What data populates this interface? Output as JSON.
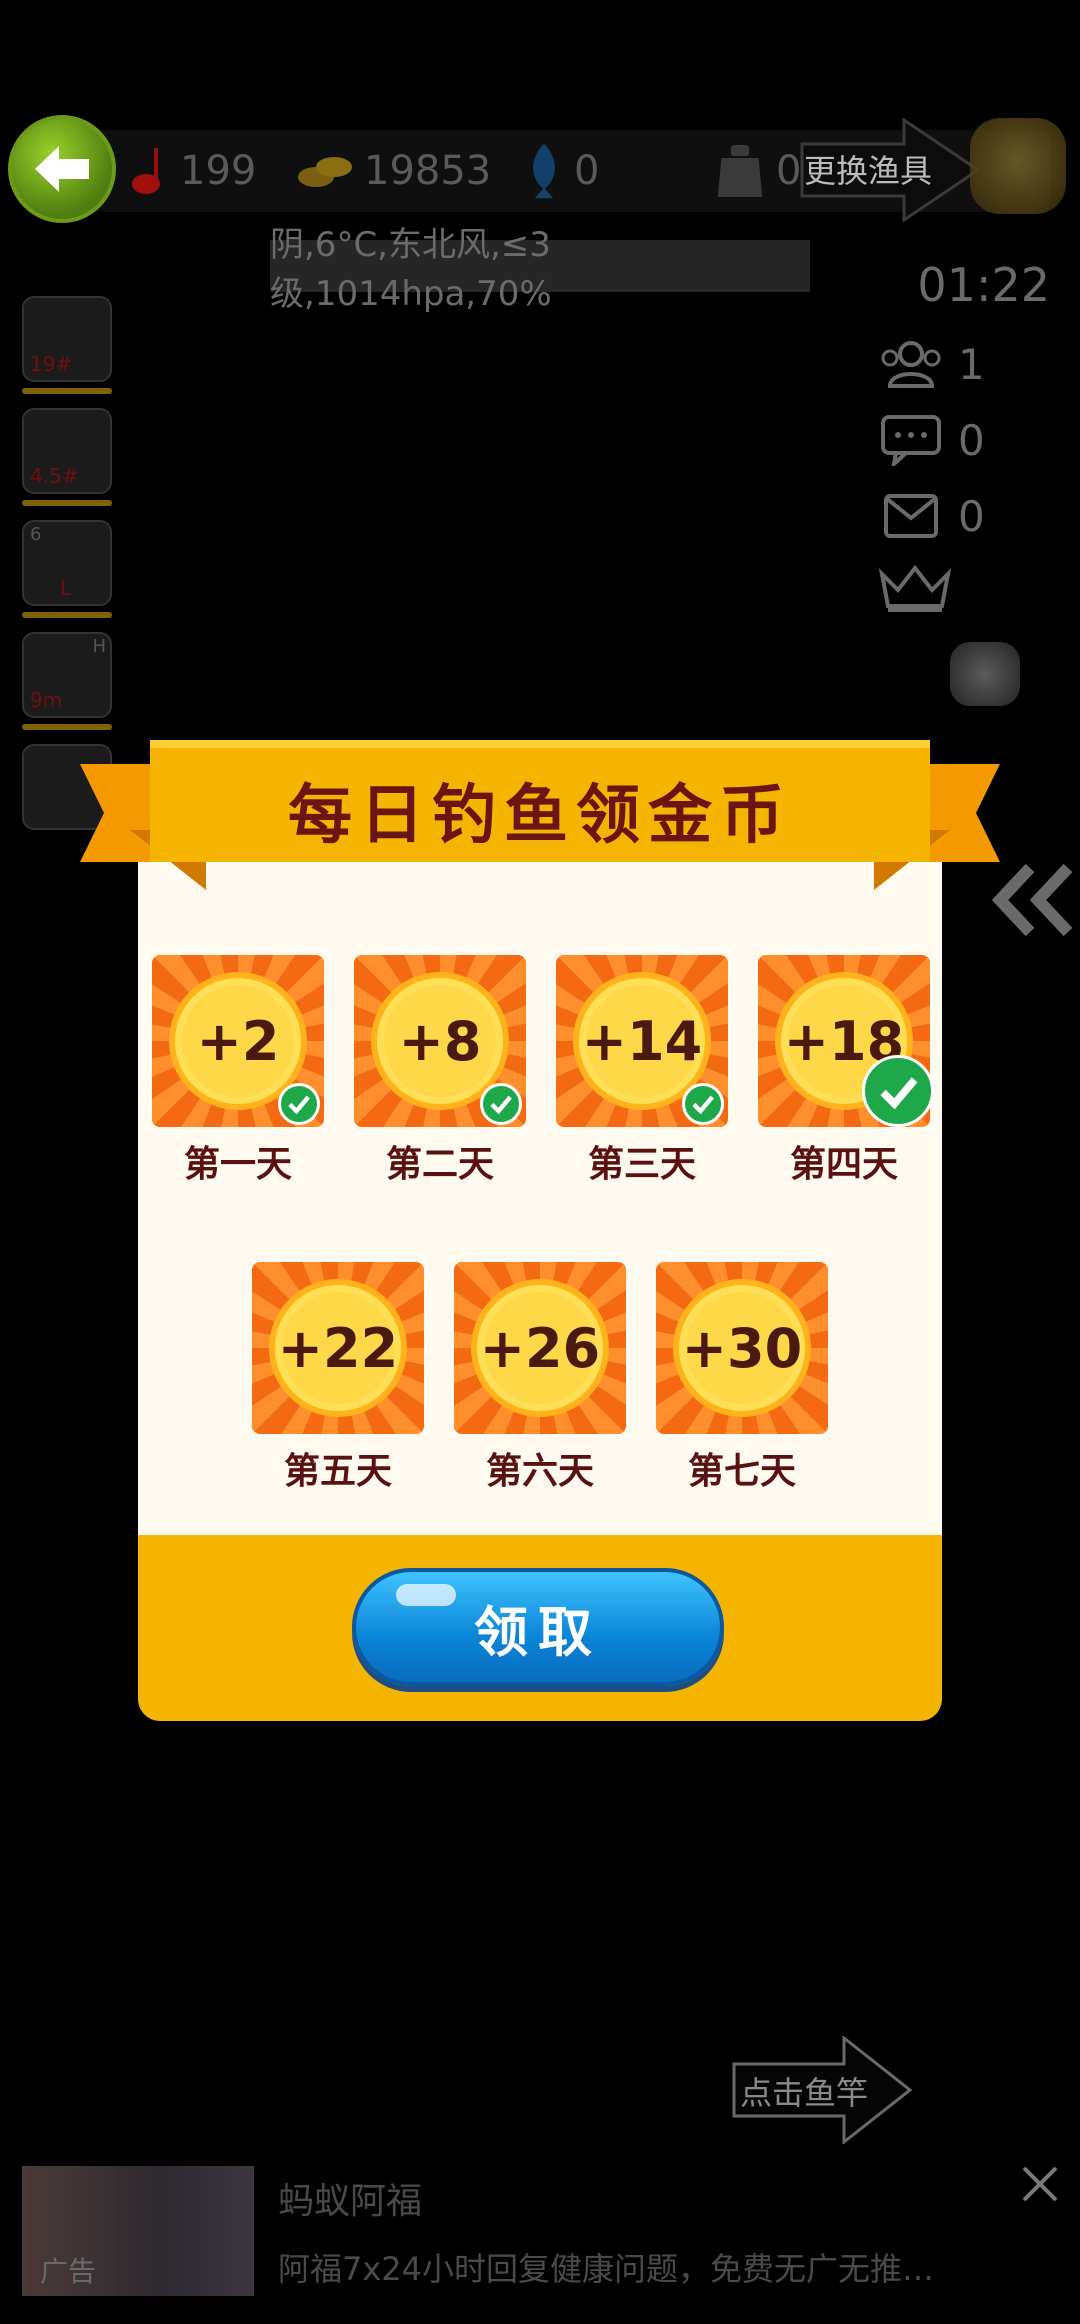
{
  "top_bar": {
    "bait": "199",
    "coins": "19853",
    "fish": "0",
    "weight": "0",
    "change_gear": "更换渔具"
  },
  "weather": "阴,6°C,东北风,≤3级,1014hpa,70%",
  "timer": "01:22",
  "side": {
    "players": "1",
    "chat": "0",
    "mail": "0"
  },
  "gear": [
    {
      "label": "19#",
      "tag": ""
    },
    {
      "label": "4.5#",
      "tag": ""
    },
    {
      "label": "L",
      "tag": "6"
    },
    {
      "label": "9m",
      "tag": "H"
    },
    {
      "label": "",
      "tag": ""
    }
  ],
  "dialog": {
    "title": "每日钓鱼领金币",
    "days": [
      {
        "value": "+2",
        "label": "第一天",
        "claimed": true
      },
      {
        "value": "+8",
        "label": "第二天",
        "claimed": true
      },
      {
        "value": "+14",
        "label": "第三天",
        "claimed": true
      },
      {
        "value": "+18",
        "label": "第四天",
        "claimed": true
      },
      {
        "value": "+22",
        "label": "第五天",
        "claimed": false
      },
      {
        "value": "+26",
        "label": "第六天",
        "claimed": false
      },
      {
        "value": "+30",
        "label": "第七天",
        "claimed": false
      }
    ],
    "claim_button": "领取"
  },
  "hint": "点击鱼竿",
  "ad": {
    "title": "蚂蚁阿福",
    "description": "阿福7x24小时回复健康问题，免费无广无推…",
    "badge": "广告"
  },
  "colors": {
    "dialog_yellow": "#f5b400",
    "title_red": "#6b1412",
    "tile_orange": "#f57a1a",
    "coin_yellow": "#ffd84a",
    "check_green": "#1ea84a",
    "claim_blue": "#0a84d6"
  },
  "icons": [
    "back-arrow-icon",
    "bait-float-icon",
    "gold-coins-icon",
    "fish-icon",
    "weight-icon",
    "gear-bag-icon",
    "players-icon",
    "chat-icon",
    "mail-icon",
    "crown-icon",
    "headlamp-icon",
    "collapse-double-chevron-icon",
    "close-icon"
  ]
}
